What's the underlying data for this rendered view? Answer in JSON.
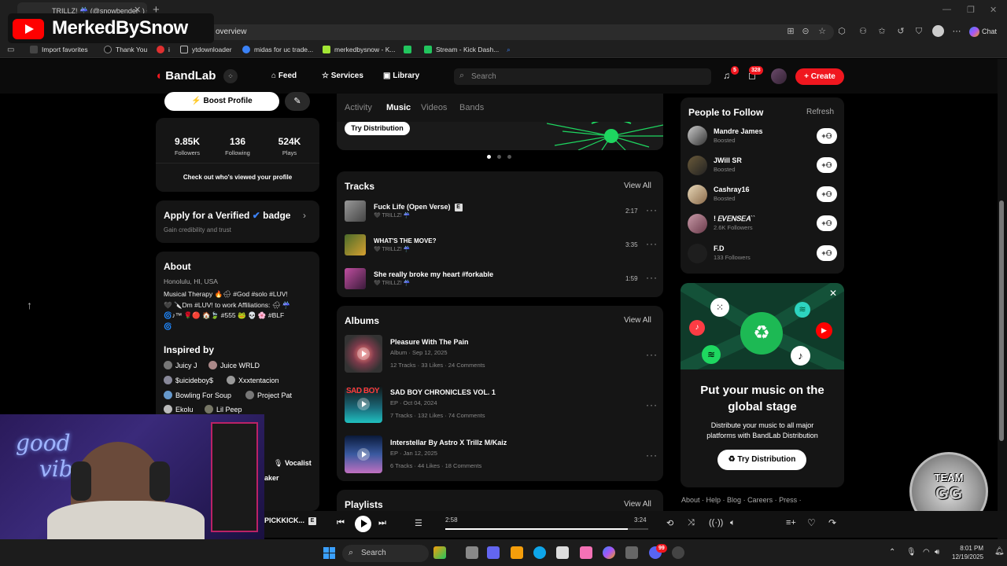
{
  "browser": {
    "tab_title": "TRILLZ! ☔ (@snowbender_) • Ba",
    "url_text": "overview",
    "chat_label": "Chat",
    "bookmarks": [
      "Import favorites",
      "Thank You",
      "i",
      "ytdownloader",
      "midas for uc trade...",
      "merkedbysnow - K...",
      "Stream - Kick Dash..."
    ]
  },
  "overlay": {
    "channel_name": "MerkedBySnow"
  },
  "header": {
    "logo_text": "BandLab",
    "nav": [
      "Feed",
      "Services",
      "Library"
    ],
    "search_placeholder": "Search",
    "notif_count": "5",
    "msg_count": "328",
    "create_label": "Create"
  },
  "left": {
    "boost_label": "Boost Profile",
    "stats": [
      {
        "value": "9.85K",
        "label": "Followers"
      },
      {
        "value": "136",
        "label": "Following"
      },
      {
        "value": "524K",
        "label": "Plays"
      }
    ],
    "viewed_text": "Check out who's viewed your profile",
    "verified_title": "Apply for a Verified",
    "verified_badge_word": "badge",
    "verified_sub": "Gain credibility and trust",
    "about_title": "About",
    "location": "Honolulu, HI, USA",
    "bio_line1": "Musical Therapy 🔥🌧 #God #solo #LUV!",
    "bio_line2": "🖤 🔪Dm #LUV! to work Affiliations: 🌧 ☔",
    "bio_line3": "🌀♪™ 🌹🔴 🏠🍃 #555 🐸 💀 🌸 #BLF",
    "bio_line4": "🌀",
    "inspired_title": "Inspired by",
    "inspired": [
      "Juicy J",
      "Juice WRLD",
      "$uicideboy$",
      "Xxxtentacion",
      "Bowling For Soup",
      "Project Pat",
      "Ekolu",
      "Lil Peep"
    ],
    "role_label": "Vocalist",
    "role2_label": "aker"
  },
  "center": {
    "tabs": [
      "Activity",
      "Music",
      "Videos",
      "Bands"
    ],
    "active_tab": "Music",
    "try_distribution": "Try Distribution",
    "tracks_title": "Tracks",
    "view_all": "View All",
    "tracks": [
      {
        "title": "Fuck Life (Open Verse)",
        "artist": "🖤 TRILLZ! ☔",
        "duration": "2:17",
        "explicit": "E"
      },
      {
        "title": "WHAT'S THE MOVE?",
        "artist": "🖤 TRILLZ! ☔",
        "duration": "3:35"
      },
      {
        "title": "She really broke my heart #forkable",
        "artist": "🖤 TRILLZ! ☔",
        "duration": "1:59"
      }
    ],
    "albums_title": "Albums",
    "albums": [
      {
        "title": "Pleasure With The Pain",
        "type": "Album",
        "date": "Sep 12, 2025",
        "tracks": "12 Tracks",
        "likes": "33 Likes",
        "comments": "24 Comments"
      },
      {
        "title": "SAD BOY CHRONICLES VOL. 1",
        "type": "EP",
        "date": "Oct 04, 2024",
        "tracks": "7 Tracks",
        "likes": "132 Likes",
        "comments": "74 Comments"
      },
      {
        "title": "Interstellar By Astro X Trillz M/Kaiz",
        "type": "EP",
        "date": "Jan 12, 2025",
        "tracks": "6 Tracks",
        "likes": "44 Likes",
        "comments": "18 Comments"
      }
    ],
    "playlists_title": "Playlists",
    "sad_boy_art": "SAD BOY"
  },
  "right": {
    "people_title": "People to Follow",
    "refresh": "Refresh",
    "people": [
      {
        "name": "Mandre James",
        "sub": "Boosted"
      },
      {
        "name": "JWill SR",
        "sub": "Boosted"
      },
      {
        "name": "Cashray16",
        "sub": "Boosted"
      },
      {
        "name": "! 𝐸𝑉𝐸𝑁𝑆𝐸𝐴ˋˋ",
        "sub": "2.6K Followers"
      },
      {
        "name": "F.D",
        "sub": "133 Followers"
      }
    ],
    "promo_title1": "Put your music on the",
    "promo_title2": "global stage",
    "promo_sub1": "Distribute your music to all major",
    "promo_sub2": "platforms with BandLab Distribution",
    "promo_btn": "Try Distribution",
    "footer_links": [
      "About",
      "Help",
      "Blog",
      "Careers",
      "Press"
    ],
    "team_badge_line1": "TEAM",
    "team_badge_line2": "GG"
  },
  "player": {
    "now_playing": "PICKKICK...",
    "explicit": "E",
    "current_time": "2:58",
    "total_time": "3:24",
    "progress": 0.9
  },
  "taskbar": {
    "search_label": "Search",
    "time": "8:01 PM",
    "date": "12/19/2025",
    "edge_badge": "99"
  },
  "webcam": {
    "neon_line1": "good",
    "neon_line2": "vibes"
  }
}
